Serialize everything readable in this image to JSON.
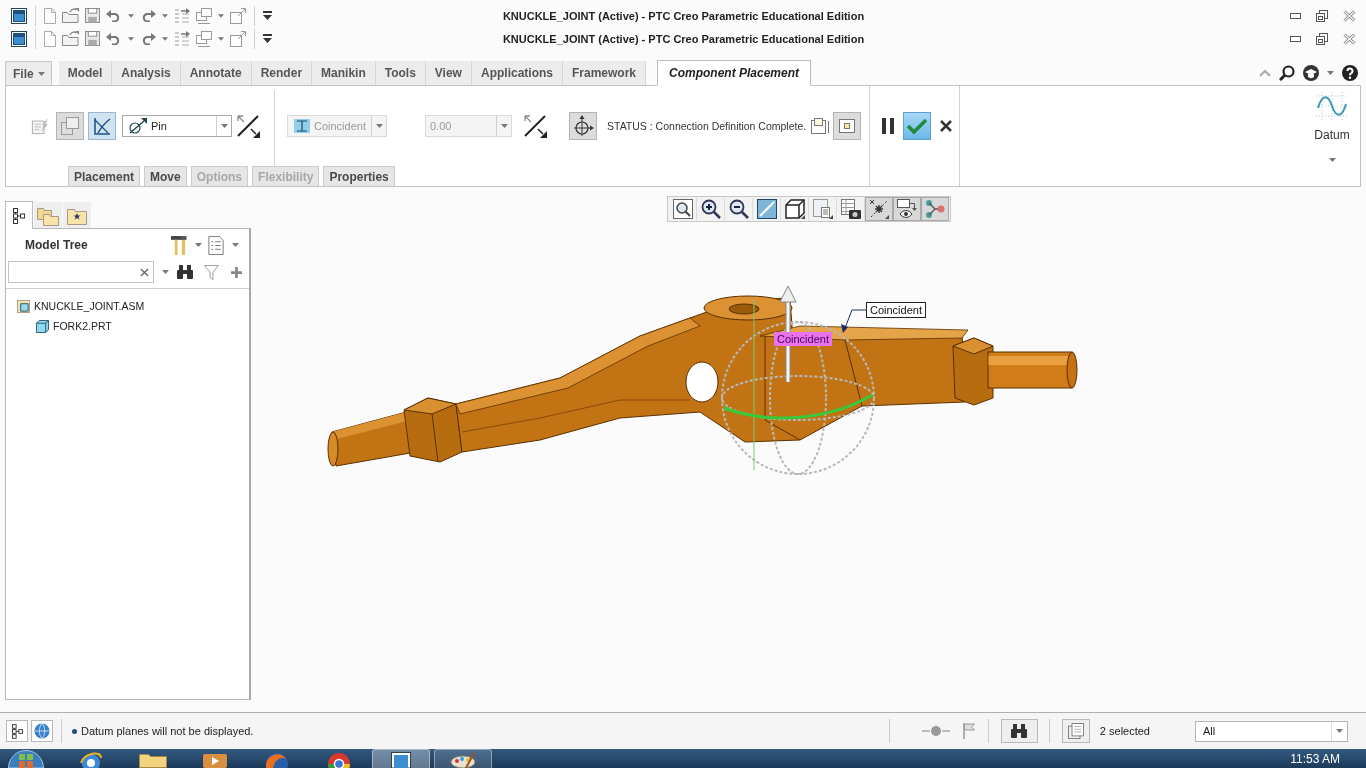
{
  "title_bars": [
    {
      "title": "KNUCKLE_JOINT (Active) - PTC Creo Parametric Educational Edition"
    },
    {
      "title": "KNUCKLE_JOINT (Active) - PTC Creo Parametric Educational Edition"
    }
  ],
  "ribbon": {
    "file_menu": "File",
    "tabs": [
      {
        "label": "Model",
        "selected": false
      },
      {
        "label": "Analysis",
        "selected": false
      },
      {
        "label": "Annotate",
        "selected": false
      },
      {
        "label": "Render",
        "selected": false
      },
      {
        "label": "Manikin",
        "selected": false
      },
      {
        "label": "Tools",
        "selected": false
      },
      {
        "label": "View",
        "selected": false
      },
      {
        "label": "Applications",
        "selected": false
      },
      {
        "label": "Framework",
        "selected": false
      },
      {
        "label": "Component Placement",
        "selected": true
      }
    ],
    "mode_buttons": [
      {
        "kind": "edit",
        "on": false
      },
      {
        "kind": "separate",
        "on": true
      },
      {
        "kind": "constraint",
        "on": true
      }
    ],
    "connection_type": {
      "value": "Pin"
    },
    "constraint": {
      "value": "Coincident",
      "disabled": true
    },
    "offset": {
      "value": "0.00",
      "disabled": true
    },
    "dragger_button": {
      "on": true
    },
    "status": "STATUS : Connection Definition Complete.",
    "preview_buttons": [
      {
        "kind": "separate-window",
        "on": false
      },
      {
        "kind": "assembly-window",
        "on": true
      }
    ],
    "finish_buttons": [
      {
        "kind": "pause",
        "highlighted": false
      },
      {
        "kind": "ok",
        "highlighted": true
      },
      {
        "kind": "cancel",
        "highlighted": false
      }
    ],
    "datum": {
      "label": "Datum"
    },
    "subtabs": [
      {
        "label": "Placement",
        "disabled": false
      },
      {
        "label": "Move",
        "disabled": false
      },
      {
        "label": "Options",
        "disabled": true
      },
      {
        "label": "Flexibility",
        "disabled": true
      },
      {
        "label": "Properties",
        "disabled": false
      }
    ]
  },
  "model_tree": {
    "tabs": [
      {
        "kind": "tree",
        "selected": true
      },
      {
        "kind": "folders",
        "selected": false
      },
      {
        "kind": "favorites",
        "selected": false
      }
    ],
    "title": "Model Tree",
    "items": [
      {
        "label": "KNUCKLE_JOINT.ASM",
        "kind": "assembly",
        "children": [
          {
            "label": "FORK2.PRT",
            "kind": "part"
          }
        ]
      }
    ]
  },
  "graphics": {
    "view_tools": [
      {
        "kind": "refit",
        "on": false
      },
      {
        "kind": "zoom-in",
        "on": false
      },
      {
        "kind": "zoom-out",
        "on": false
      },
      {
        "kind": "repaint",
        "on": false
      },
      {
        "kind": "orientation",
        "on": false
      },
      {
        "kind": "saved-views",
        "on": false
      },
      {
        "kind": "display-style",
        "on": false
      },
      {
        "kind": "datum-display",
        "on": true
      },
      {
        "kind": "spin-center",
        "on": true
      },
      {
        "kind": "connections",
        "on": true
      }
    ],
    "callouts": [
      {
        "kind": "boxed",
        "text": "Coincident"
      },
      {
        "kind": "highlighted",
        "text": "Coincident"
      }
    ]
  },
  "status_bar": {
    "message": "Datum planes will not be displayed.",
    "selection": "2 selected",
    "filter": "All"
  },
  "taskbar": {
    "apps": [
      {
        "kind": "ie",
        "open": false,
        "selected": false
      },
      {
        "kind": "explorer",
        "open": false,
        "selected": false
      },
      {
        "kind": "media",
        "open": false,
        "selected": false
      },
      {
        "kind": "firefox",
        "open": false,
        "selected": false
      },
      {
        "kind": "chrome",
        "open": false,
        "selected": false
      },
      {
        "kind": "creo",
        "open": true,
        "selected": true
      },
      {
        "kind": "paint",
        "open": true,
        "selected": false
      }
    ],
    "clock": "11:53 AM"
  }
}
